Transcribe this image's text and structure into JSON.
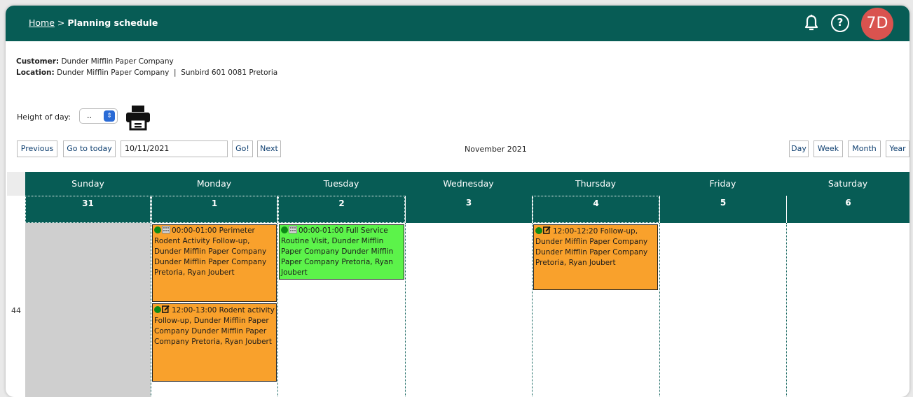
{
  "header": {
    "breadcrumb_home": "Home",
    "breadcrumb_sep": " > ",
    "breadcrumb_current": "Planning schedule",
    "avatar_initials": "7D",
    "help_glyph": "?",
    "icons": [
      "bell-icon",
      "help-icon"
    ],
    "brand_color": "#075c55",
    "avatar_color": "#d9534f"
  },
  "info": {
    "customer_label": "Customer:",
    "customer_value": "Dunder Mifflin Paper Company",
    "location_label": "Location:",
    "location_value": "Dunder Mifflin Paper Company  |  Sunbird 601 0081 Pretoria"
  },
  "controls": {
    "height_of_day_label": "Height of day:",
    "height_of_day_value": "..",
    "previous": "Previous",
    "go_to_today": "Go to today",
    "date_value": "10/11/2021",
    "go": "Go!",
    "next": "Next",
    "month_label": "November 2021",
    "view_day": "Day",
    "view_week": "Week",
    "view_month": "Month",
    "view_year": "Year"
  },
  "calendar": {
    "week_number": "44",
    "days": [
      "Sunday",
      "Monday",
      "Tuesday",
      "Wednesday",
      "Thursday",
      "Friday",
      "Saturday"
    ],
    "dates": [
      "31",
      "1",
      "2",
      "3",
      "4",
      "5",
      "6"
    ],
    "events": {
      "mon1": "00:00-01:00 Perimeter Rodent Activity Follow-up, Dunder Mifflin Paper Company Dunder Mifflin Paper Company Pretoria, Ryan Joubert",
      "mon2": "12:00-13:00 Rodent activity Follow-up, Dunder Mifflin Paper Company Dunder Mifflin Paper Company Pretoria, Ryan Joubert",
      "tue1": "00:00-01:00 Full Service Routine Visit, Dunder Mifflin Paper Company Dunder Mifflin Paper Company Pretoria, Ryan Joubert",
      "thu1": "12:00-12:20 Follow-up, Dunder Mifflin Paper Company Dunder Mifflin Paper Company Pretoria, Ryan Joubert"
    },
    "event_colors": {
      "orange": "#f9a12c",
      "green": "#5cf34a",
      "status_dot": "#0c8a16"
    }
  }
}
